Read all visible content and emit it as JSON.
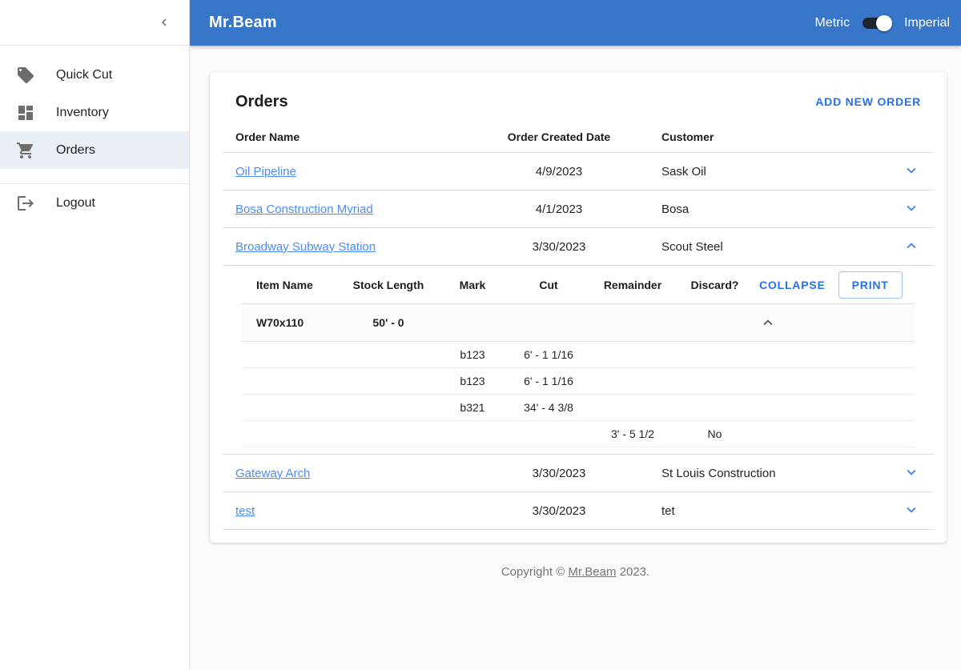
{
  "appbar": {
    "title": "Mr.Beam",
    "unit_toggle": {
      "left_label": "Metric",
      "right_label": "Imperial",
      "selected": "Imperial"
    }
  },
  "sidebar": {
    "items": [
      {
        "label": "Quick Cut",
        "icon": "tag-icon",
        "active": false
      },
      {
        "label": "Inventory",
        "icon": "dashboard-icon",
        "active": false
      },
      {
        "label": "Orders",
        "icon": "cart-icon",
        "active": true
      }
    ],
    "logout_label": "Logout"
  },
  "orders": {
    "title": "Orders",
    "add_button_label": "ADD NEW ORDER",
    "columns": {
      "name": "Order Name",
      "created": "Order Created Date",
      "customer": "Customer"
    },
    "rows": [
      {
        "name": "Oil Pipeline",
        "created": "4/9/2023",
        "customer": "Sask Oil",
        "expanded": false
      },
      {
        "name": "Bosa Construction Myriad",
        "created": "4/1/2023",
        "customer": "Bosa",
        "expanded": false
      },
      {
        "name": "Broadway Subway Station",
        "created": "3/30/2023",
        "customer": "Scout Steel",
        "expanded": true
      },
      {
        "name": "Gateway Arch",
        "created": "3/30/2023",
        "customer": "St Louis Construction",
        "expanded": false
      },
      {
        "name": "test",
        "created": "3/30/2023",
        "customer": "tet",
        "expanded": false
      }
    ],
    "detail": {
      "columns": {
        "item": "Item Name",
        "stock": "Stock Length",
        "mark": "Mark",
        "cut": "Cut",
        "remainder": "Remainder",
        "discard": "Discard?"
      },
      "collapse_button_label": "COLLAPSE",
      "print_button_label": "PRINT",
      "item": {
        "name": "W70x110",
        "stock_length": "50' - 0",
        "expanded": true
      },
      "cuts": [
        {
          "mark": "b123",
          "cut": "6' - 1 1/16"
        },
        {
          "mark": "b123",
          "cut": "6' - 1 1/16"
        },
        {
          "mark": "b321",
          "cut": "34' - 4 3/8"
        }
      ],
      "summary": {
        "remainder": "3' - 5 1/2",
        "discard": "No"
      }
    }
  },
  "footer": {
    "prefix": "Copyright ©",
    "link_label": "Mr.Beam",
    "suffix": "2023."
  },
  "colors": {
    "appbar_bg": "#3776c9",
    "accent_blue": "#2471eb",
    "link_blue": "#4d8cf5",
    "active_nav_bg": "#eaeef5"
  }
}
